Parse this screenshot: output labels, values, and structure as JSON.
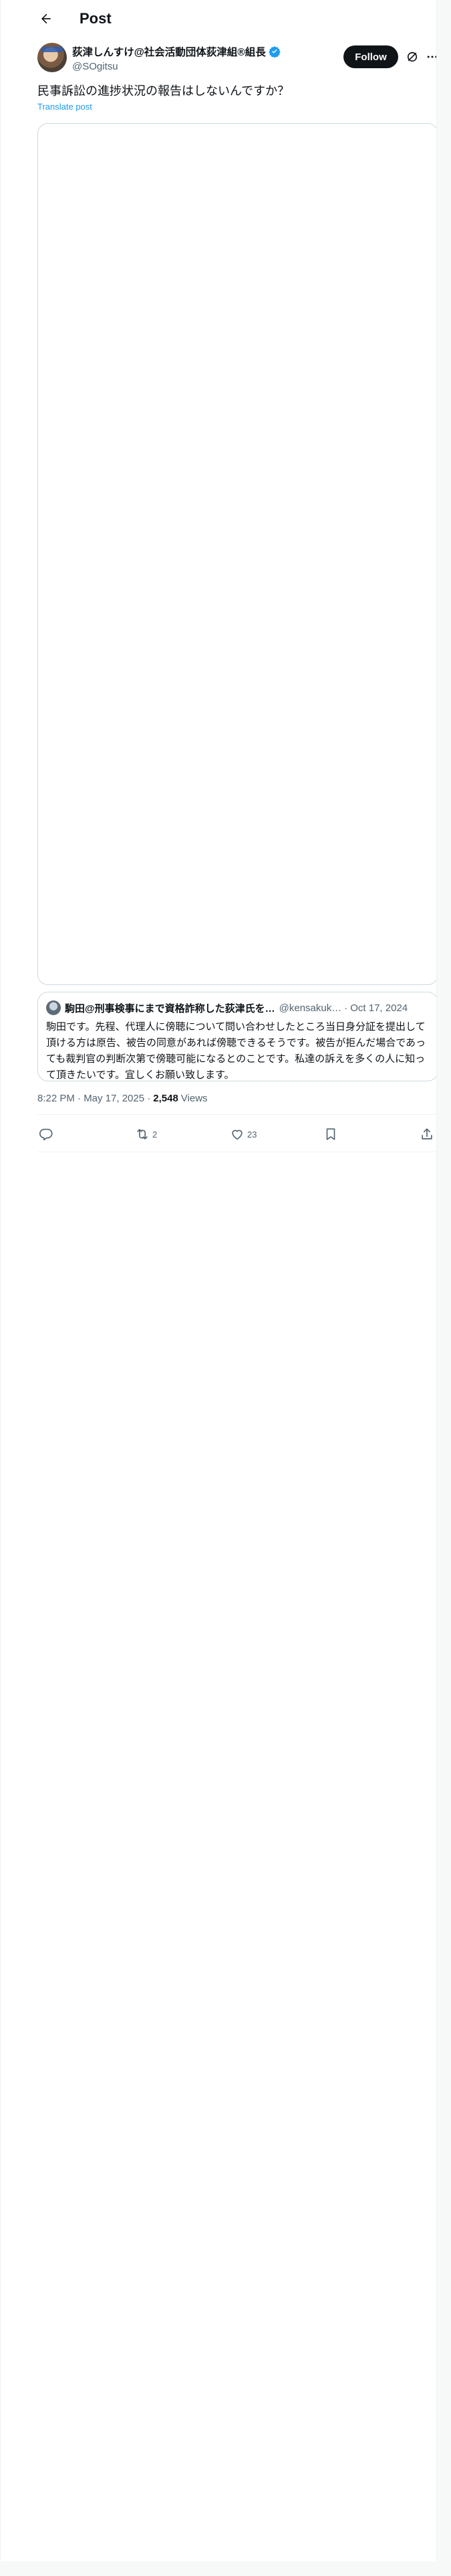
{
  "header": {
    "title": "Post"
  },
  "author": {
    "display_name": "荻津しんすけ@社会活動団体荻津組®組長",
    "handle": "@SOgitsu",
    "follow_label": "Follow"
  },
  "tweet": {
    "text": "民事訴訟の進捗状況の報告はしないんですか？",
    "translate_label": "Translate post"
  },
  "quote": {
    "display_name": "駒田@刑事検事にまで資格詐称した荻津氏を…",
    "handle": "@kensakuk…",
    "dot": "·",
    "date": "Oct 17, 2024",
    "text": "駒田です。先程、代理人に傍聴について問い合わせしたところ当日身分証を提出して頂ける方は原告、被告の同意があれば傍聴できるそうです。被告が拒んだ場合であっても裁判官の判断次第で傍聴可能になるとのことです。私達の訴えを多くの人に知って頂きたいです。宜しくお願い致します。"
  },
  "meta": {
    "time": "8:22 PM · May 17, 2025 ·",
    "views_count": "2,548",
    "views_label": "Views"
  },
  "actions": {
    "reply_count": "",
    "repost_count": "2",
    "like_count": "23"
  },
  "colors": {
    "accent": "#1d9bf0",
    "text": "#0f1419",
    "secondary": "#536471",
    "border": "#cfd9de"
  },
  "icons": [
    "back-arrow-icon",
    "verified-badge-icon",
    "grok-icon",
    "more-icon",
    "reply-icon",
    "repost-icon",
    "like-icon",
    "bookmark-icon",
    "share-icon"
  ]
}
